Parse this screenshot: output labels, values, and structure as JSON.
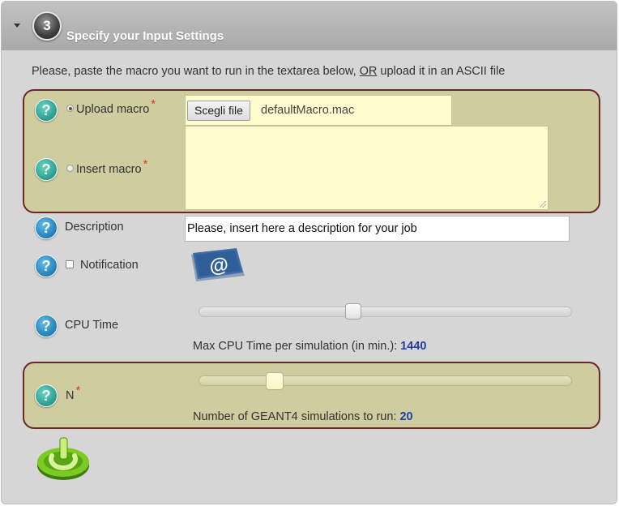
{
  "header": {
    "step_number": "3",
    "title": "Specify your Input Settings"
  },
  "intro": {
    "text_before": "Please, paste the macro you want to run in the textarea below, ",
    "or": "OR",
    "text_after": " upload it in an ASCII file"
  },
  "help_glyph": "?",
  "required_mark": "*",
  "upload_macro": {
    "label": "Upload macro",
    "selected": true,
    "button_label": "Scegli file",
    "file_name": "defaultMacro.mac"
  },
  "insert_macro": {
    "label": "Insert macro",
    "selected": false,
    "value": ""
  },
  "description": {
    "label": "Description",
    "value": "Please, insert here a description for your job"
  },
  "notification": {
    "label": "Notification",
    "checked": false,
    "icon": "email-at-icon",
    "glyph": "@"
  },
  "cpu_time": {
    "label": "CPU Time",
    "caption": "Max CPU Time per simulation (in min.): ",
    "value": "1440",
    "slider_fraction": 0.41
  },
  "n_simulations": {
    "label": "N",
    "caption": "Number of GEANT4 simulations to run: ",
    "value": "20",
    "slider_fraction": 0.19
  },
  "submit": {
    "icon": "power-button-icon"
  },
  "colors": {
    "highlight_bg": "#cfcda0",
    "highlight_border": "#6b2626",
    "value_blue": "#1f3fa6",
    "required_red": "#e03a1a",
    "power_green": "#6fbf1a"
  }
}
